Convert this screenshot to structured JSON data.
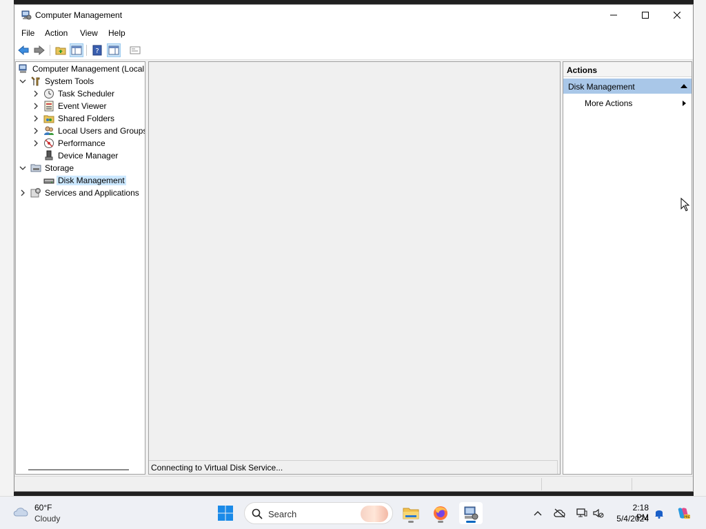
{
  "window": {
    "title": "Computer Management",
    "menu": [
      "File",
      "Action",
      "View",
      "Help"
    ]
  },
  "tree": {
    "root": "Computer Management (Local",
    "items": [
      {
        "label": "System Tools",
        "level": 1,
        "expander": "expanded",
        "icon": "tools-icon"
      },
      {
        "label": "Task Scheduler",
        "level": 2,
        "expander": "collapsed",
        "icon": "clock-icon"
      },
      {
        "label": "Event Viewer",
        "level": 2,
        "expander": "collapsed",
        "icon": "event-viewer-icon"
      },
      {
        "label": "Shared Folders",
        "level": 2,
        "expander": "collapsed",
        "icon": "shared-folder-icon"
      },
      {
        "label": "Local Users and Groups",
        "level": 2,
        "expander": "collapsed",
        "icon": "users-icon"
      },
      {
        "label": "Performance",
        "level": 2,
        "expander": "collapsed",
        "icon": "performance-icon"
      },
      {
        "label": "Device Manager",
        "level": 2,
        "expander": "none",
        "icon": "device-manager-icon"
      },
      {
        "label": "Storage",
        "level": 1,
        "expander": "expanded",
        "icon": "storage-icon"
      },
      {
        "label": "Disk Management",
        "level": 2,
        "expander": "none",
        "icon": "disk-icon",
        "selected": true
      },
      {
        "label": "Services and Applications",
        "level": 1,
        "expander": "collapsed",
        "icon": "services-icon"
      }
    ]
  },
  "center": {
    "status": "Connecting to Virtual Disk Service..."
  },
  "actions": {
    "header": "Actions",
    "section": "Disk Management",
    "more": "More Actions"
  },
  "taskbar": {
    "weather_temp": "60°F",
    "weather_desc": "Cloudy",
    "search_placeholder": "Search",
    "time": "2:18 PM",
    "date": "5/4/2024"
  },
  "colors": {
    "selection": "#cce8ff",
    "actions_section": "#a9c7e8",
    "accent": "#0067c0"
  }
}
